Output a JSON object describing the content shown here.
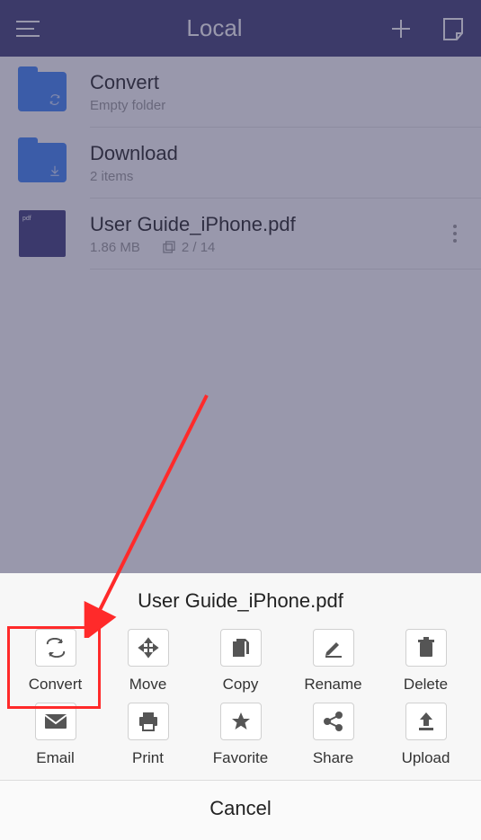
{
  "header": {
    "title": "Local"
  },
  "files": [
    {
      "name": "Convert",
      "subtitle": "Empty folder",
      "type": "folder",
      "inner_icon": "sync"
    },
    {
      "name": "Download",
      "subtitle": "2 items",
      "type": "folder",
      "inner_icon": "download"
    },
    {
      "name": "User Guide_iPhone.pdf",
      "size": "1.86 MB",
      "pages": "2 / 14",
      "type": "pdf"
    }
  ],
  "sheet": {
    "title": "User Guide_iPhone.pdf",
    "actions": [
      {
        "key": "convert",
        "label": "Convert"
      },
      {
        "key": "move",
        "label": "Move"
      },
      {
        "key": "copy",
        "label": "Copy"
      },
      {
        "key": "rename",
        "label": "Rename"
      },
      {
        "key": "delete",
        "label": "Delete"
      },
      {
        "key": "email",
        "label": "Email"
      },
      {
        "key": "print",
        "label": "Print"
      },
      {
        "key": "favorite",
        "label": "Favorite"
      },
      {
        "key": "share",
        "label": "Share"
      },
      {
        "key": "upload",
        "label": "Upload"
      }
    ],
    "cancel_label": "Cancel"
  }
}
